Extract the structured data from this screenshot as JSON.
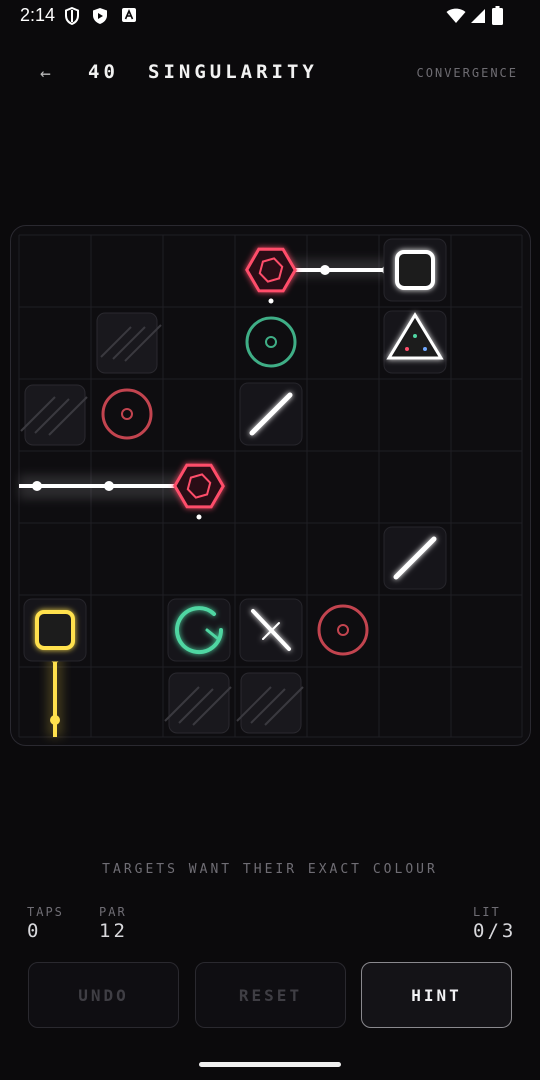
{
  "status_bar": {
    "time": "2:14",
    "left_icons": [
      "shield-icon",
      "play-protect-icon",
      "font-icon"
    ],
    "right_icons": [
      "wifi-icon",
      "signal-icon",
      "battery-icon"
    ]
  },
  "header": {
    "back_icon": "←",
    "level_number": "40",
    "level_name": "SINGULARITY",
    "pack_name": "CONVERGENCE"
  },
  "board": {
    "rows": 7,
    "cols": 7,
    "colors": {
      "white": "#ffffff",
      "red": "#ff4d6a",
      "green": "#4fd6a2",
      "yellow": "#ffe14d",
      "target_red_dim": "#c2444f",
      "target_green_dim": "#3fae86"
    },
    "pieces": [
      {
        "type": "emitter-hexagon",
        "row": 0,
        "col": 3,
        "color": "red"
      },
      {
        "type": "emitter-square",
        "row": 0,
        "col": 5,
        "color": "white"
      },
      {
        "type": "blocker",
        "row": 1,
        "col": 1
      },
      {
        "type": "target",
        "row": 1,
        "col": 3,
        "color": "green"
      },
      {
        "type": "prism",
        "row": 1,
        "col": 5
      },
      {
        "type": "blocker",
        "row": 2,
        "col": 0
      },
      {
        "type": "target",
        "row": 2,
        "col": 1,
        "color": "red"
      },
      {
        "type": "mirror",
        "row": 2,
        "col": 3,
        "orientation": "/"
      },
      {
        "type": "emitter-hexagon",
        "row": 3,
        "col": 2,
        "color": "red"
      },
      {
        "type": "mirror",
        "row": 4,
        "col": 5,
        "orientation": "/"
      },
      {
        "type": "emitter-square",
        "row": 5,
        "col": 0,
        "color": "yellow"
      },
      {
        "type": "target-lit",
        "row": 5,
        "col": 2,
        "color": "green"
      },
      {
        "type": "splitter",
        "row": 5,
        "col": 3,
        "orientation": "\\"
      },
      {
        "type": "target",
        "row": 5,
        "col": 4,
        "color": "red"
      },
      {
        "type": "blocker",
        "row": 6,
        "col": 2
      },
      {
        "type": "blocker",
        "row": 6,
        "col": 3
      }
    ]
  },
  "rule_hint": "TARGETS WANT THEIR EXACT COLOUR",
  "stats": {
    "taps_label": "TAPS",
    "taps_value": "0",
    "par_label": "PAR",
    "par_value": "12",
    "lit_label": "LIT",
    "lit_value": "0/3"
  },
  "buttons": {
    "undo": "UNDO",
    "reset": "RESET",
    "hint": "HINT"
  }
}
